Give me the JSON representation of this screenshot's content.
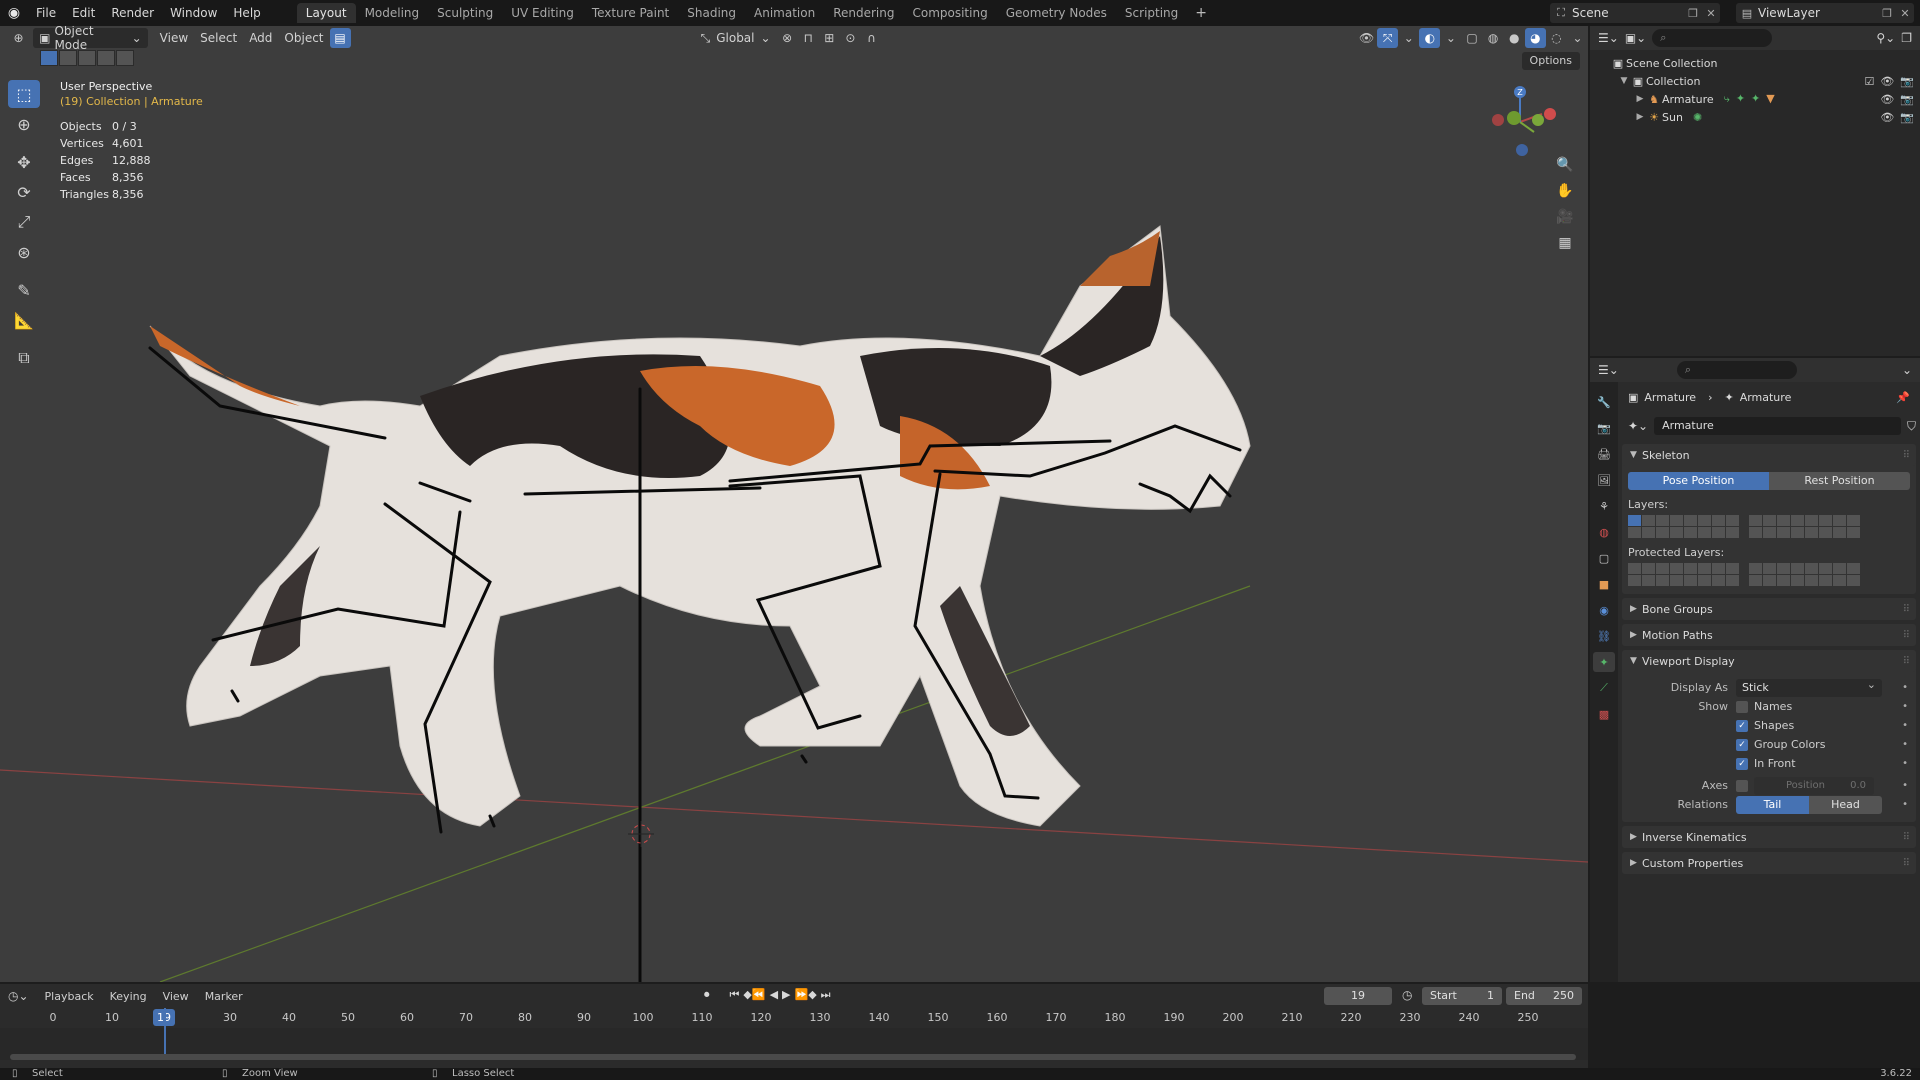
{
  "topbar": {
    "menus": [
      "File",
      "Edit",
      "Render",
      "Window",
      "Help"
    ],
    "workspaces": [
      "Layout",
      "Modeling",
      "Sculpting",
      "UV Editing",
      "Texture Paint",
      "Shading",
      "Animation",
      "Rendering",
      "Compositing",
      "Geometry Nodes",
      "Scripting"
    ],
    "active_workspace": "Layout",
    "scene": "Scene",
    "view_layer": "ViewLayer"
  },
  "viewport": {
    "mode": "Object Mode",
    "menus": [
      "View",
      "Select",
      "Add",
      "Object"
    ],
    "orientation": "Global",
    "options_label": "Options",
    "perspective": "User Perspective",
    "context": "(19) Collection | Armature",
    "stats": [
      {
        "label": "Objects",
        "value": "0 / 3"
      },
      {
        "label": "Vertices",
        "value": "4,601"
      },
      {
        "label": "Edges",
        "value": "12,888"
      },
      {
        "label": "Faces",
        "value": "8,356"
      },
      {
        "label": "Triangles",
        "value": "8,356"
      }
    ],
    "gizmo_z": "Z",
    "colors": {
      "bg": "#3d3d3d",
      "x_axis": "#b04a4a",
      "y_axis": "#6b8c2e",
      "accent": "#4672b3"
    }
  },
  "outliner": {
    "root": "Scene Collection",
    "collection": "Collection",
    "items": [
      {
        "name": "Armature",
        "icon": "armature-icon"
      },
      {
        "name": "Sun",
        "icon": "light-icon"
      }
    ]
  },
  "properties": {
    "breadcrumb": [
      "Armature",
      "Armature"
    ],
    "datablock": "Armature",
    "skeleton": {
      "title": "Skeleton",
      "pose_position": "Pose Position",
      "rest_position": "Rest Position",
      "layers_label": "Layers:",
      "protected_label": "Protected Layers:"
    },
    "bone_groups": "Bone Groups",
    "motion_paths": "Motion Paths",
    "viewport_display": {
      "title": "Viewport Display",
      "display_as_label": "Display As",
      "display_as_value": "Stick",
      "show_label": "Show",
      "names": "Names",
      "shapes": "Shapes",
      "group_colors": "Group Colors",
      "in_front": "In Front",
      "axes_label": "Axes",
      "position_label": "Position",
      "position_value": "0.0",
      "relations_label": "Relations",
      "tail": "Tail",
      "head": "Head"
    },
    "inverse_kinematics": "Inverse Kinematics",
    "custom_properties": "Custom Properties"
  },
  "timeline": {
    "menus": [
      "Playback",
      "Keying",
      "View",
      "Marker"
    ],
    "current_frame": "19",
    "start_label": "Start",
    "start_value": "1",
    "end_label": "End",
    "end_value": "250",
    "ticks": [
      "0",
      "10",
      "30",
      "40",
      "50",
      "60",
      "70",
      "80",
      "90",
      "100",
      "110",
      "120",
      "130",
      "140",
      "150",
      "160",
      "170",
      "180",
      "190",
      "200",
      "210",
      "220",
      "230",
      "240",
      "250"
    ]
  },
  "statusbar": {
    "select": "Select",
    "zoom": "Zoom View",
    "lasso": "Lasso Select",
    "version": "3.6.22"
  }
}
